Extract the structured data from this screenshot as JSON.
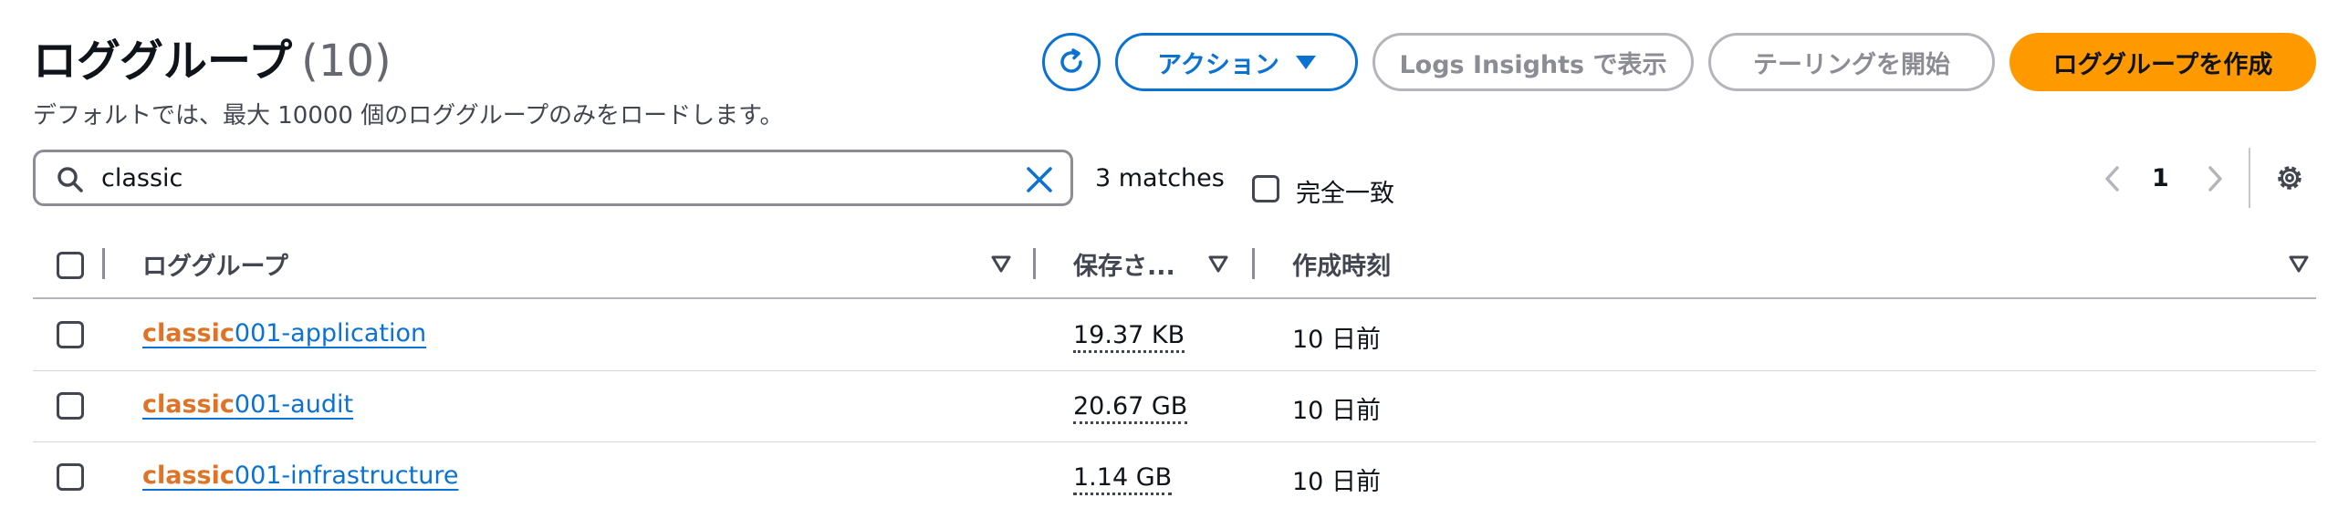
{
  "header": {
    "title": "ロググループ",
    "count": "(10)",
    "subtitle": "デフォルトでは、最大 10000 個のロググループのみをロードします。"
  },
  "toolbar": {
    "refresh_icon": "refresh-icon",
    "actions_label": "アクション",
    "insights_label": "Logs Insights で表示",
    "tailing_label": "テーリングを開始",
    "create_label": "ロググループを作成"
  },
  "search": {
    "value": "classic",
    "matches": "3 matches",
    "exact_label": "完全一致"
  },
  "pagination": {
    "page": "1"
  },
  "table": {
    "headers": {
      "name": "ロググループ",
      "size": "保存さ...",
      "created": "作成時刻"
    },
    "rows": [
      {
        "name_match": "classic",
        "name_rest": "001-application",
        "size": "19.37 KB",
        "created": "10 日前"
      },
      {
        "name_match": "classic",
        "name_rest": "001-audit",
        "size": "20.67 GB",
        "created": "10 日前"
      },
      {
        "name_match": "classic",
        "name_rest": "001-infrastructure",
        "size": "1.14 GB",
        "created": "10 日前"
      }
    ]
  },
  "colors": {
    "primary": "#0972d3",
    "accent": "#ff9900",
    "highlight": "#e07426",
    "disabled": "#8c8c94"
  }
}
